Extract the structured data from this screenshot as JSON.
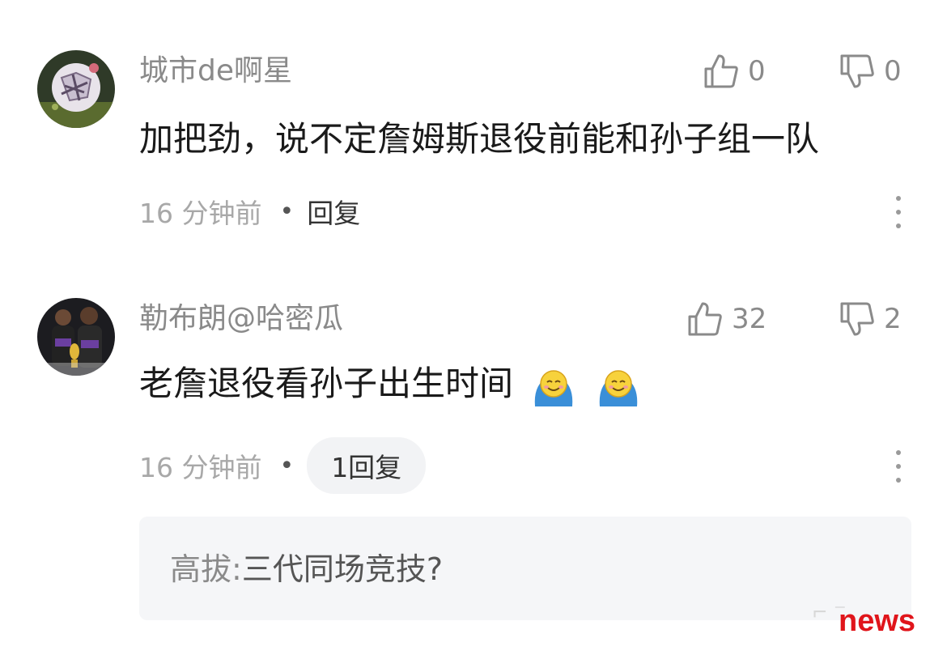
{
  "comments": [
    {
      "username": "城市de啊星",
      "likes": "0",
      "dislikes": "0",
      "text": "加把劲，说不定詹姆斯退役前能和孙子组一队",
      "time": "16 分钟前",
      "reply_label": "回复",
      "avatar_icon": "soccer-ball-avatar"
    },
    {
      "username": "勒布朗@哈密瓜",
      "likes": "32",
      "dislikes": "2",
      "text": "老詹退役看孙子出生时间",
      "emojis": [
        "smiling-emoji",
        "smiling-emoji"
      ],
      "time": "16 分钟前",
      "reply_count_label": "1回复",
      "avatar_icon": "players-trophy-avatar",
      "replies": [
        {
          "author": "高拔",
          "separator": ":",
          "text": "三代同场竞技?"
        }
      ]
    }
  ],
  "icons": {
    "like": "thumbs-up-icon",
    "dislike": "thumbs-down-icon",
    "more": "more-vertical-icon"
  },
  "watermark": "news",
  "colors": {
    "username": "#8a8a8a",
    "body": "#1a1a1a",
    "watermark": "#e0151b",
    "reply_bg": "#f5f6f8"
  }
}
